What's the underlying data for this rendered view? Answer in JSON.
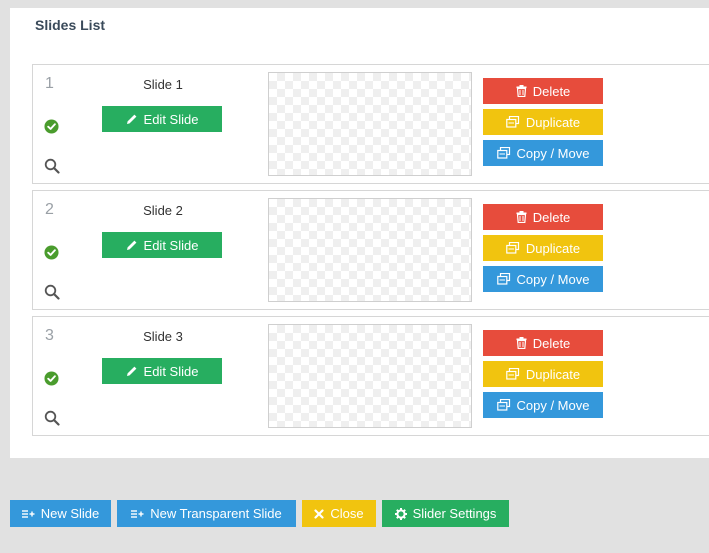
{
  "panel": {
    "title": "Slides List"
  },
  "slides": [
    {
      "number": "1",
      "name": "Slide 1",
      "edit_label": "Edit Slide",
      "delete_label": "Delete",
      "duplicate_label": "Duplicate",
      "copy_label": "Copy / Move"
    },
    {
      "number": "2",
      "name": "Slide 2",
      "edit_label": "Edit Slide",
      "delete_label": "Delete",
      "duplicate_label": "Duplicate",
      "copy_label": "Copy / Move"
    },
    {
      "number": "3",
      "name": "Slide 3",
      "edit_label": "Edit Slide",
      "delete_label": "Delete",
      "duplicate_label": "Duplicate",
      "copy_label": "Copy / Move"
    }
  ],
  "footer": {
    "new_slide": "New Slide",
    "new_transparent_slide": "New Transparent Slide",
    "close": "Close",
    "slider_settings": "Slider Settings"
  },
  "colors": {
    "green": "#27ae60",
    "red": "#e74c3c",
    "yellow": "#f1c40f",
    "blue": "#3498db"
  },
  "icons": [
    "pencil-icon",
    "trash-icon",
    "duplicate-icon",
    "copy-move-icon",
    "check-circle-icon",
    "magnifier-icon",
    "list-plus-icon",
    "close-x-icon",
    "gear-icon"
  ]
}
